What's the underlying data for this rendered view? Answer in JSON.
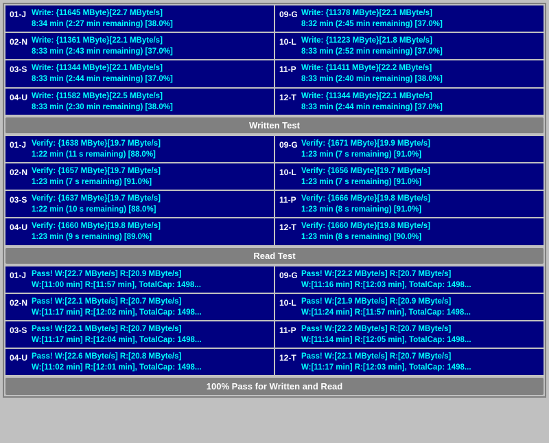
{
  "sections": {
    "write_test": {
      "label": "Written Test",
      "rows_left": [
        {
          "id": "01-J",
          "line1": "Write: {11645 MByte}[22.7 MByte/s]",
          "line2": "8:34 min (2:27 min remaining)  [38.0%]"
        },
        {
          "id": "02-N",
          "line1": "Write: {11361 MByte}[22.1 MByte/s]",
          "line2": "8:33 min (2:43 min remaining)  [37.0%]"
        },
        {
          "id": "03-S",
          "line1": "Write: {11344 MByte}[22.1 MByte/s]",
          "line2": "8:33 min (2:44 min remaining)  [37.0%]"
        },
        {
          "id": "04-U",
          "line1": "Write: {11582 MByte}[22.5 MByte/s]",
          "line2": "8:33 min (2:30 min remaining)  [38.0%]"
        }
      ],
      "rows_right": [
        {
          "id": "09-G",
          "line1": "Write: {11378 MByte}[22.1 MByte/s]",
          "line2": "8:32 min (2:45 min remaining)  [37.0%]"
        },
        {
          "id": "10-L",
          "line1": "Write: {11223 MByte}[21.8 MByte/s]",
          "line2": "8:33 min (2:52 min remaining)  [37.0%]"
        },
        {
          "id": "11-P",
          "line1": "Write: {11411 MByte}[22.2 MByte/s]",
          "line2": "8:33 min (2:40 min remaining)  [38.0%]"
        },
        {
          "id": "12-T",
          "line1": "Write: {11344 MByte}[22.1 MByte/s]",
          "line2": "8:33 min (2:44 min remaining)  [37.0%]"
        }
      ]
    },
    "verify_test": {
      "label": "Written Test",
      "rows_left": [
        {
          "id": "01-J",
          "line1": "Verify: {1638 MByte}[19.7 MByte/s]",
          "line2": "1:22 min (11 s remaining)   [88.0%]"
        },
        {
          "id": "02-N",
          "line1": "Verify: {1657 MByte}[19.7 MByte/s]",
          "line2": "1:23 min (7 s remaining)   [91.0%]"
        },
        {
          "id": "03-S",
          "line1": "Verify: {1637 MByte}[19.7 MByte/s]",
          "line2": "1:22 min (10 s remaining)   [88.0%]"
        },
        {
          "id": "04-U",
          "line1": "Verify: {1660 MByte}[19.8 MByte/s]",
          "line2": "1:23 min (9 s remaining)   [89.0%]"
        }
      ],
      "rows_right": [
        {
          "id": "09-G",
          "line1": "Verify: {1671 MByte}[19.9 MByte/s]",
          "line2": "1:23 min (7 s remaining)   [91.0%]"
        },
        {
          "id": "10-L",
          "line1": "Verify: {1656 MByte}[19.7 MByte/s]",
          "line2": "1:23 min (7 s remaining)   [91.0%]"
        },
        {
          "id": "11-P",
          "line1": "Verify: {1666 MByte}[19.8 MByte/s]",
          "line2": "1:23 min (8 s remaining)   [91.0%]"
        },
        {
          "id": "12-T",
          "line1": "Verify: {1660 MByte}[19.8 MByte/s]",
          "line2": "1:23 min (8 s remaining)   [90.0%]"
        }
      ]
    },
    "read_test": {
      "label": "Read Test",
      "rows_left": [
        {
          "id": "01-J",
          "line1": "Pass! W:[22.7 MByte/s] R:[20.9 MByte/s]",
          "line2": "W:[11:00 min] R:[11:57 min], TotalCap: 1498..."
        },
        {
          "id": "02-N",
          "line1": "Pass! W:[22.1 MByte/s] R:[20.7 MByte/s]",
          "line2": "W:[11:17 min] R:[12:02 min], TotalCap: 1498..."
        },
        {
          "id": "03-S",
          "line1": "Pass! W:[22.1 MByte/s] R:[20.7 MByte/s]",
          "line2": "W:[11:17 min] R:[12:04 min], TotalCap: 1498..."
        },
        {
          "id": "04-U",
          "line1": "Pass! W:[22.6 MByte/s] R:[20.8 MByte/s]",
          "line2": "W:[11:02 min] R:[12:01 min], TotalCap: 1498..."
        }
      ],
      "rows_right": [
        {
          "id": "09-G",
          "line1": "Pass! W:[22.2 MByte/s] R:[20.7 MByte/s]",
          "line2": "W:[11:16 min] R:[12:03 min], TotalCap: 1498..."
        },
        {
          "id": "10-L",
          "line1": "Pass! W:[21.9 MByte/s] R:[20.9 MByte/s]",
          "line2": "W:[11:24 min] R:[11:57 min], TotalCap: 1498..."
        },
        {
          "id": "11-P",
          "line1": "Pass! W:[22.2 MByte/s] R:[20.7 MByte/s]",
          "line2": "W:[11:14 min] R:[12:05 min], TotalCap: 1498..."
        },
        {
          "id": "12-T",
          "line1": "Pass! W:[22.1 MByte/s] R:[20.7 MByte/s]",
          "line2": "W:[11:17 min] R:[12:03 min], TotalCap: 1498..."
        }
      ]
    }
  },
  "footer": {
    "label": "100% Pass for Written and Read"
  }
}
